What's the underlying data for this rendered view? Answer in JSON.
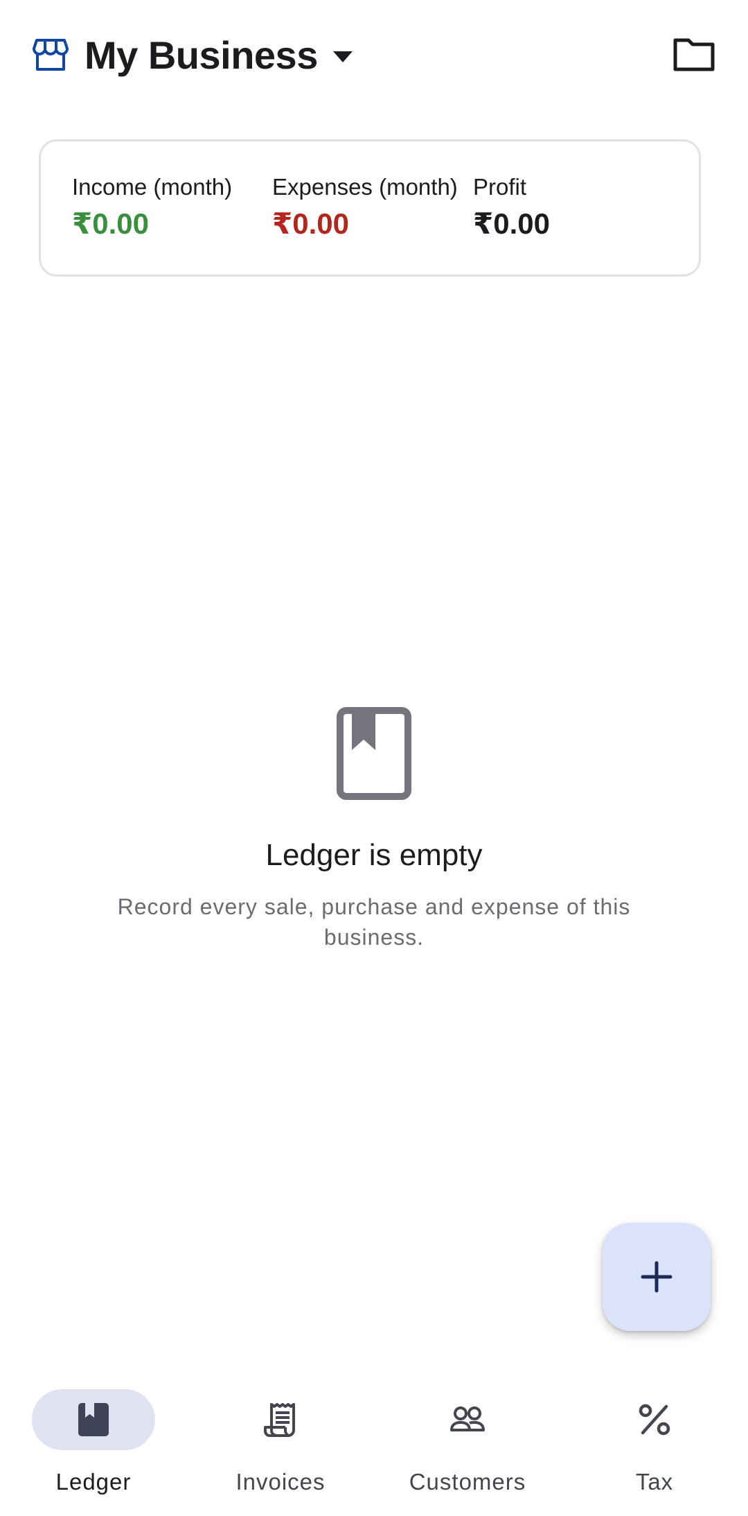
{
  "header": {
    "business_name": "My Business",
    "store_icon": "storefront-icon",
    "dropdown_icon": "arrow-drop-down-icon",
    "folder_icon": "folder-icon"
  },
  "summary": {
    "income_label": "Income (month)",
    "income_value": "₹0.00",
    "expenses_label": "Expenses (month)",
    "expenses_value": "₹0.00",
    "profit_label": "Profit",
    "profit_value": "₹0.00"
  },
  "empty_state": {
    "icon": "book-icon",
    "title": "Ledger is empty",
    "description": "Record every sale, purchase and expense of this business."
  },
  "fab": {
    "icon": "plus-icon"
  },
  "bottom_nav": {
    "items": [
      {
        "label": "Ledger",
        "icon": "book-icon",
        "active": true
      },
      {
        "label": "Invoices",
        "icon": "receipt-icon",
        "active": false
      },
      {
        "label": "Customers",
        "icon": "group-icon",
        "active": false
      },
      {
        "label": "Tax",
        "icon": "percent-icon",
        "active": false
      }
    ]
  },
  "colors": {
    "primary": "#0d47a1",
    "income": "#3a8f3e",
    "expenses": "#b3261e",
    "profit": "#1c1b1f",
    "active_indicator": "#dfe3f0",
    "fab_background": "#dbe3fb"
  }
}
